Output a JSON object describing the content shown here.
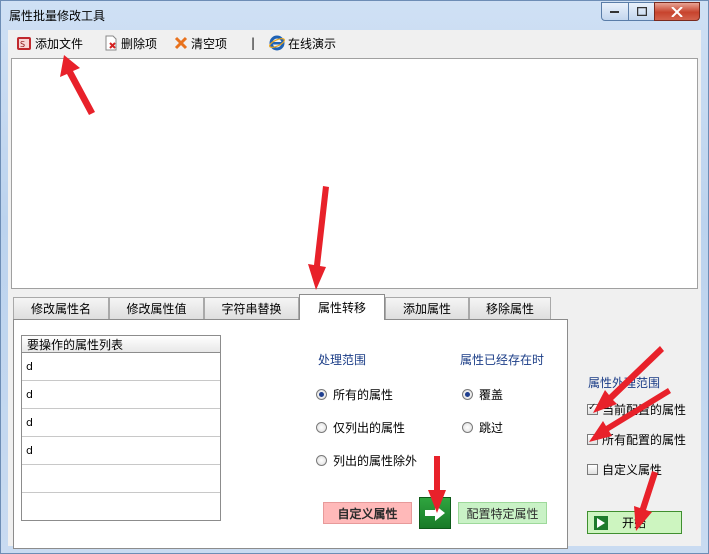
{
  "window": {
    "title": "属性批量修改工具"
  },
  "toolbar": {
    "add_file": "添加文件",
    "delete_item": "删除项",
    "clear": "清空项",
    "separator": "|",
    "online_demo": "在线演示"
  },
  "tabs": [
    {
      "label": "修改属性名"
    },
    {
      "label": "修改属性值"
    },
    {
      "label": "字符串替换"
    },
    {
      "label": "属性转移",
      "active": true
    },
    {
      "label": "添加属性"
    },
    {
      "label": "移除属性"
    }
  ],
  "attr_list": {
    "header": "要操作的属性列表",
    "rows": [
      "d",
      "d",
      "d",
      "d",
      "",
      ""
    ]
  },
  "scope": {
    "title": "处理范围",
    "options": [
      {
        "label": "所有的属性",
        "selected": true
      },
      {
        "label": "仅列出的属性",
        "selected": false
      },
      {
        "label": "列出的属性除外",
        "selected": false
      }
    ]
  },
  "exists": {
    "title": "属性已经存在时",
    "options": [
      {
        "label": "覆盖",
        "selected": true
      },
      {
        "label": "跳过",
        "selected": false
      }
    ]
  },
  "buttons": {
    "custom_attr": "自定义属性",
    "config_specific": "配置特定属性",
    "start": "开始"
  },
  "external_scope": {
    "title": "属性外理范围",
    "options": [
      {
        "label": "当前配置的属性",
        "checked": true
      },
      {
        "label": "所有配置的属性",
        "checked": false
      },
      {
        "label": "自定义属性",
        "checked": false
      }
    ]
  },
  "colors": {
    "annotation_arrow": "#e8212a",
    "accent_blue": "#1b3d87",
    "custom_btn": "#ffb9b9",
    "config_btn": "#c9f2c6",
    "start_btn": "#cdf5c0"
  }
}
